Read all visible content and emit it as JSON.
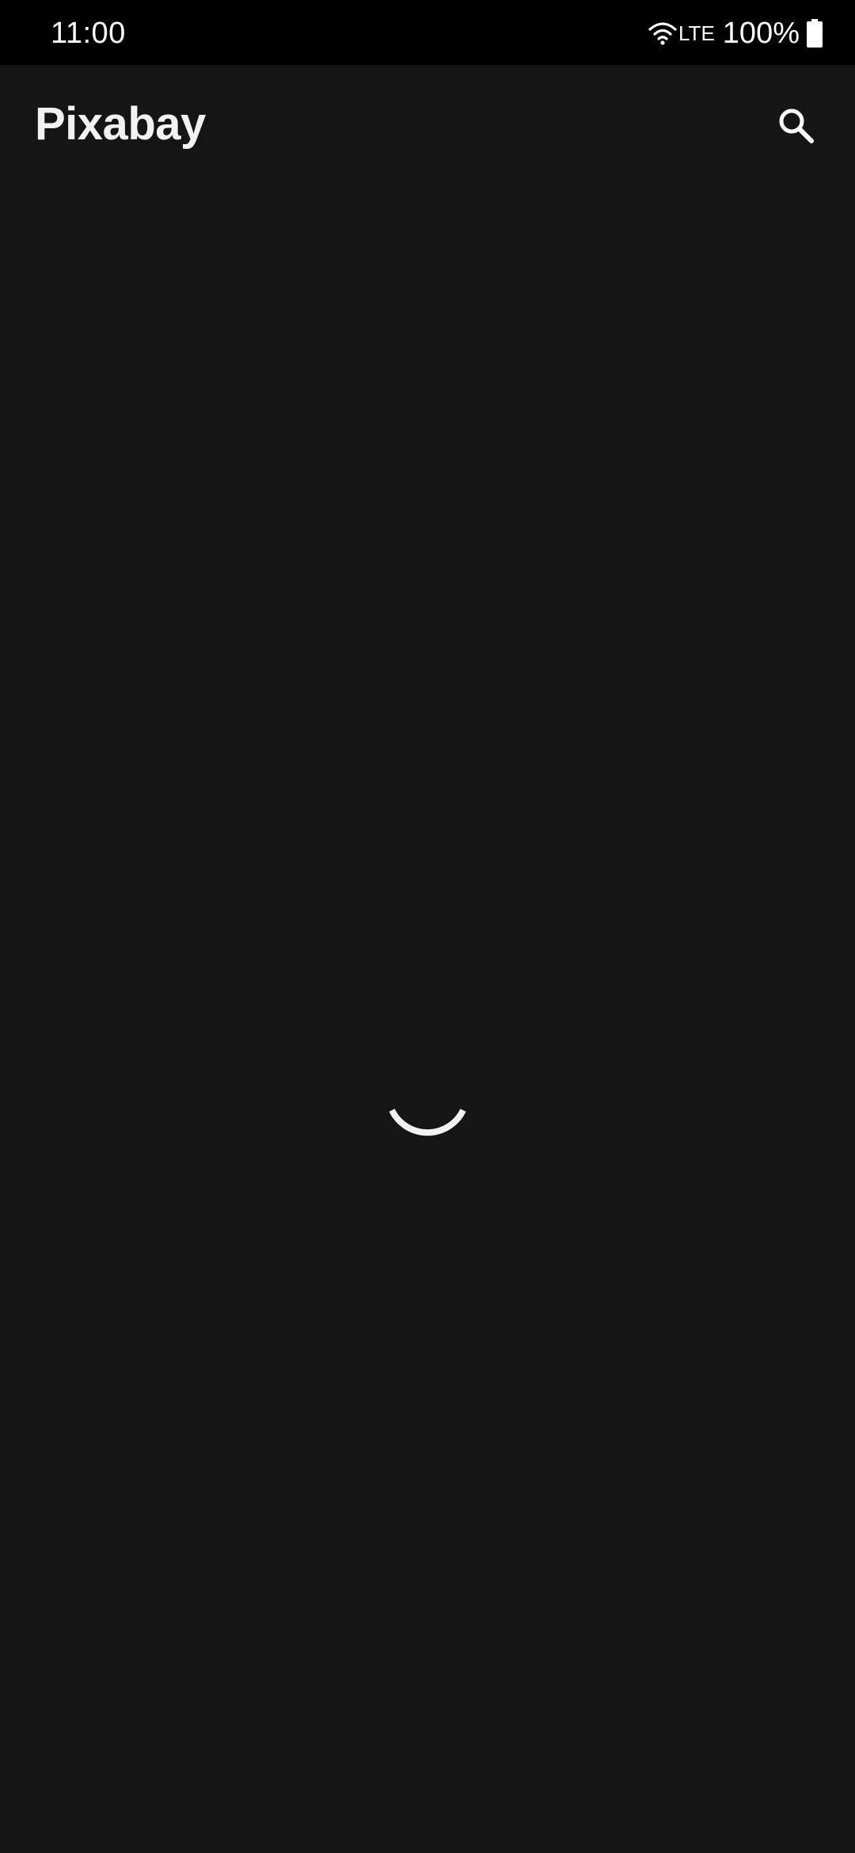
{
  "status_bar": {
    "time": "11:00",
    "network": "LTE",
    "battery": "100%",
    "icons": [
      "wifi-icon",
      "battery-icon"
    ]
  },
  "app_bar": {
    "title": "Pixabay",
    "search_icon": "search-icon"
  },
  "content": {
    "state": "loading",
    "indicator_icon": "loading-spinner-icon"
  },
  "colors": {
    "status_bar_bg": "#000000",
    "background": "#151515",
    "text": "#ffffff",
    "spinner": "#ffffff"
  }
}
